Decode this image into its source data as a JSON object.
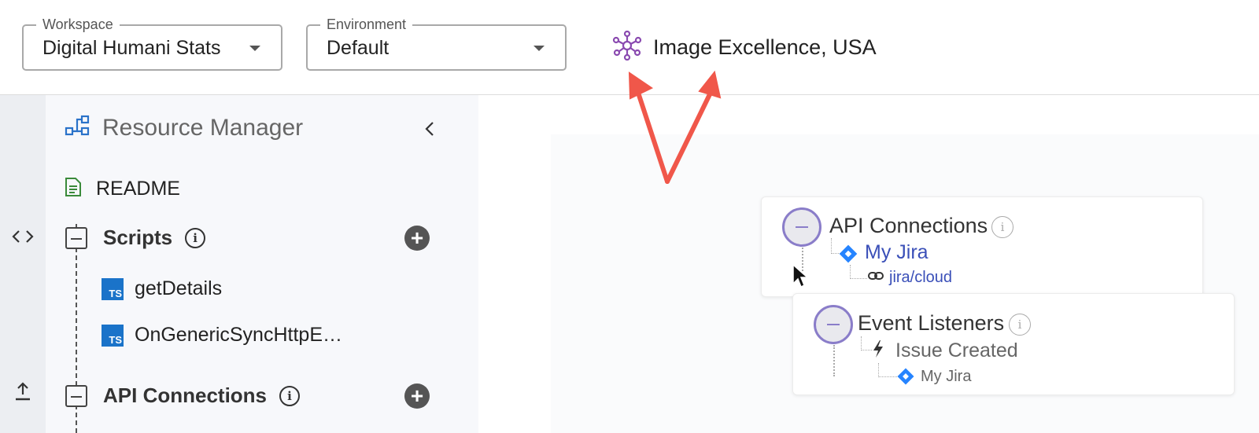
{
  "header": {
    "workspace": {
      "legend": "Workspace",
      "value": "Digital Humani Stats"
    },
    "environment": {
      "legend": "Environment",
      "value": "Default"
    },
    "org": {
      "icon": "network-icon",
      "label": "Image Excellence, USA"
    }
  },
  "rail": {
    "items": [
      {
        "icon": "code-icon"
      },
      {
        "icon": "upload-icon"
      }
    ]
  },
  "sidebar": {
    "title": "Resource Manager",
    "title_icon": "resource-manager-icon",
    "readme": "README",
    "scripts": {
      "label": "Scripts",
      "items": [
        "getDetails",
        "OnGenericSyncHttpE…"
      ],
      "badge": "TS"
    },
    "api_connections": {
      "label": "API Connections"
    }
  },
  "canvas": {
    "api_card": {
      "title": "API Connections",
      "connection": "My Jira",
      "link": "jira/cloud"
    },
    "events_card": {
      "title": "Event Listeners",
      "event": "Issue Created",
      "connection": "My Jira"
    },
    "info_glyph": "i"
  },
  "colors": {
    "annotation_arrow": "#f0574a",
    "accent_purple": "#8a4ab0",
    "link_blue": "#3a4fb8",
    "jira_blue": "#2684ff",
    "ts_blue": "#1a73c9",
    "readme_green": "#3a8a3a"
  }
}
